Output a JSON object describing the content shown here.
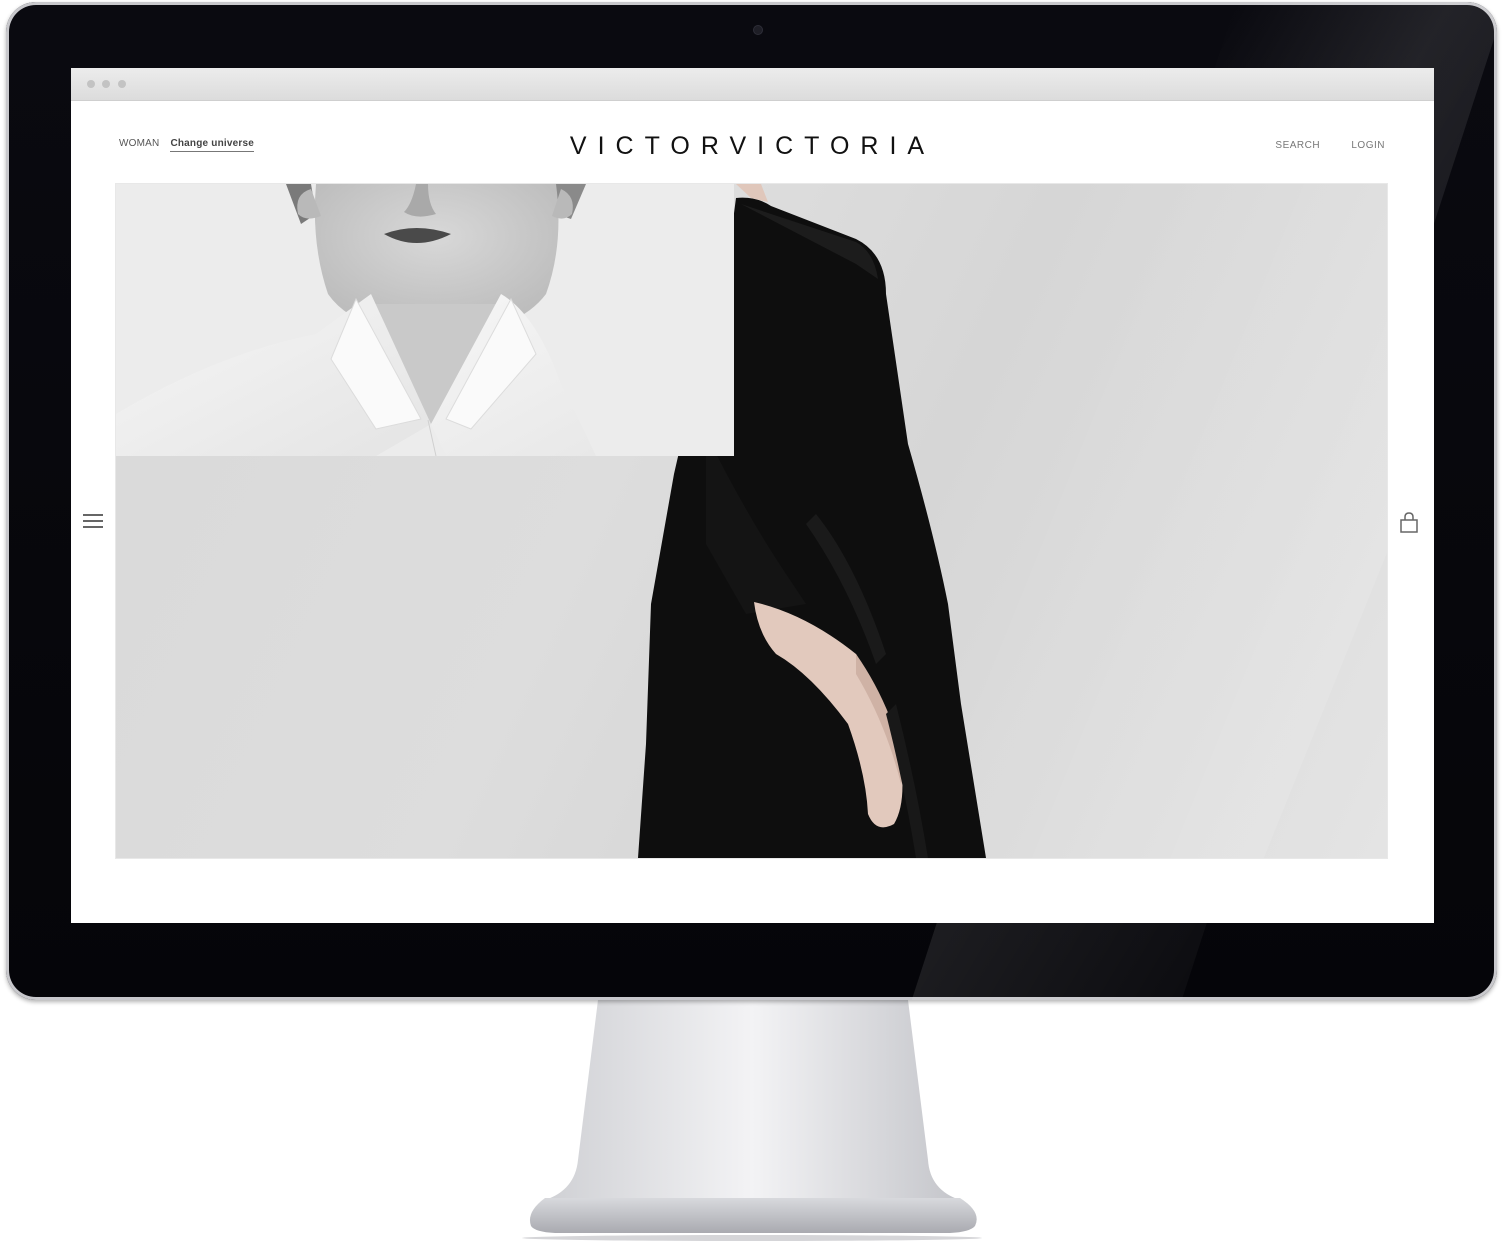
{
  "website": {
    "brand": "VICTORVICTORIA",
    "universe_label": "WOMAN",
    "change_universe": "Change universe",
    "search": "SEARCH",
    "login": "LOGIN"
  },
  "icons": {
    "menu": "hamburger-menu-icon",
    "cart": "shopping-bag-icon"
  },
  "colors": {
    "bezel": "#07070c",
    "brand_text": "#111111",
    "hero_bg": "#dadada",
    "garment": "#0d0d0d"
  }
}
